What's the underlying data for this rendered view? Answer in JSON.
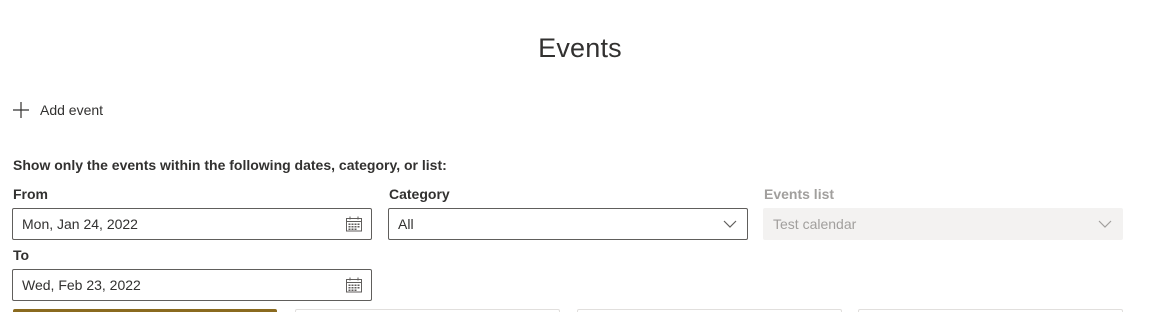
{
  "page": {
    "title": "Events"
  },
  "actions": {
    "add_event_label": "Add event"
  },
  "filters": {
    "heading": "Show only the events within the following dates, category, or list:",
    "from": {
      "label": "From",
      "value": "Mon, Jan 24, 2022",
      "icon": "calendar-icon"
    },
    "category": {
      "label": "Category",
      "value": "All",
      "icon": "chevron-down-icon"
    },
    "events_list": {
      "label": "Events list",
      "value": "Test calendar",
      "icon": "chevron-down-icon",
      "disabled": true
    },
    "to": {
      "label": "To",
      "value": "Wed, Feb 23, 2022",
      "icon": "calendar-icon"
    }
  },
  "colors": {
    "accent": "#8a6a1f",
    "text": "#323130",
    "disabled_text": "#a19f9d",
    "disabled_bg": "#f3f2f1",
    "border": "#605e5c"
  }
}
